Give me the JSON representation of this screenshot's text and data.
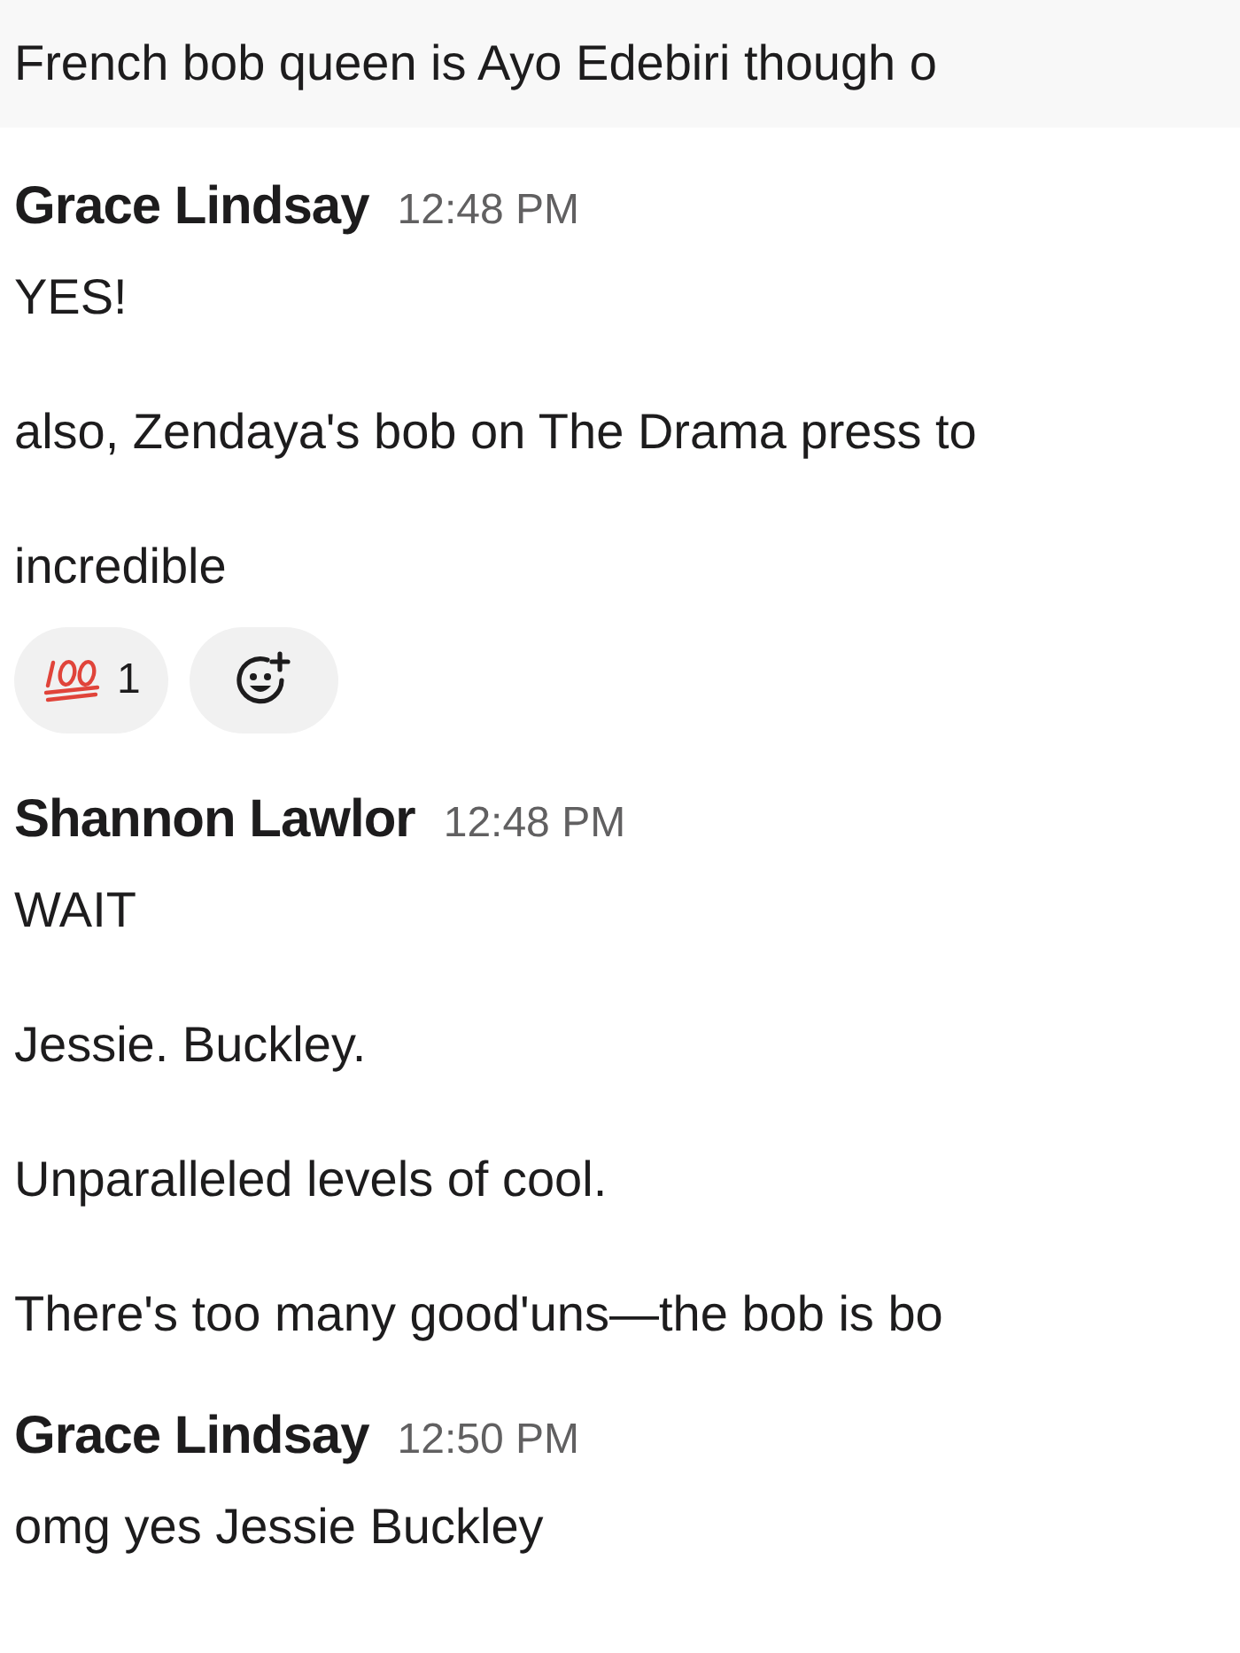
{
  "top_message": {
    "text": "French bob queen is Ayo Edebiri though o"
  },
  "messages": [
    {
      "author": "Grace Lindsay",
      "time": "12:48 PM",
      "paragraphs": [
        "YES!",
        "also, Zendaya's bob on The Drama press to",
        "incredible"
      ],
      "reactions": [
        {
          "kind": "hundred",
          "count": "1"
        },
        {
          "kind": "add"
        }
      ]
    },
    {
      "author": "Shannon Lawlor",
      "time": "12:48 PM",
      "paragraphs": [
        "WAIT",
        "Jessie. Buckley.",
        "Unparalleled levels of cool.",
        "There's too many good'uns—the bob is bo"
      ]
    },
    {
      "author": "Grace Lindsay",
      "time": "12:50 PM",
      "paragraphs": [
        "omg yes Jessie Buckley"
      ]
    }
  ]
}
